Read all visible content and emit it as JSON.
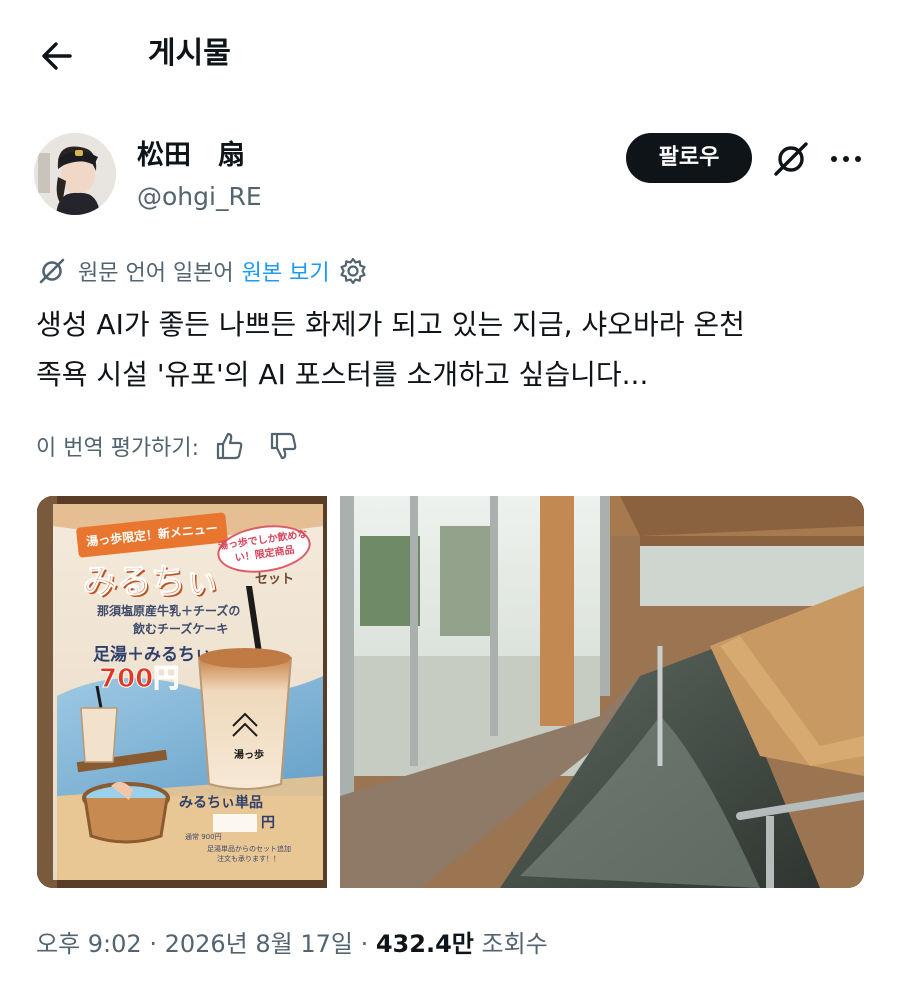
{
  "header": {
    "title": "게시물",
    "back_icon": "arrow-left-icon"
  },
  "author": {
    "display_name": "松田　扇",
    "handle": "@ohgi_RE",
    "follow_label": "팔로우",
    "grok_icon": "grok-icon",
    "more_icon": "more-horizontal-icon"
  },
  "translation": {
    "source_label": "원문 언어 일본어",
    "view_original": "원본 보기",
    "settings_icon": "gear-icon"
  },
  "tweet": {
    "line1": "생성 AI가 좋든 나쁘든 화제가 되고 있는 지금, 샤오바라 온천",
    "line2": "족욕 시설 '유포'의 AI 포스터를 소개하고 싶습니다..."
  },
  "rate": {
    "label": "이 번역 평가하기:",
    "like_icon": "thumbs-up-icon",
    "dislike_icon": "thumbs-down-icon"
  },
  "poster": {
    "banner": "湯っ歩限定！新メニュー",
    "badge": "湯っ歩でしか飲めない！限定商品",
    "title": "みるちぃ",
    "title_suffix": "セット",
    "subtitle1": "那須塩原産牛乳＋チーズの",
    "subtitle2": "飲むチーズケーキ",
    "combo": "足湯＋みるちぃ",
    "combo_price": "700円",
    "cup_logo": "湯っ歩",
    "single": "みるちぃ単品",
    "single_price": "円",
    "note1": "通常 900円",
    "note2": "足湯単品からのセット追加",
    "note3": "注文も承ります！！"
  },
  "meta": {
    "time": "오후 9:02",
    "date": "2026년 8월 17일",
    "views_number": "432.4만",
    "views_label": "조회수"
  },
  "colors": {
    "accent": "#1d9bf0",
    "text": "#0f1419",
    "secondary": "#536471"
  }
}
